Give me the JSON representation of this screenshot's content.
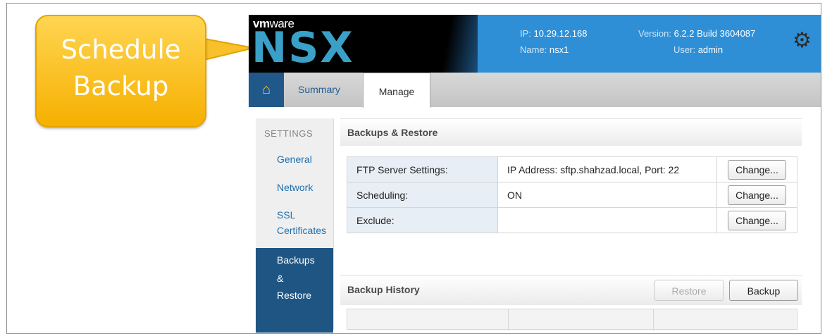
{
  "callout": {
    "line1": "Schedule",
    "line2": "Backup"
  },
  "header": {
    "brand_vm": "vm",
    "brand_ware": "ware",
    "product": "NSX",
    "ip_label": "IP:",
    "ip_value": "10.29.12.168",
    "version_label": "Version:",
    "version_value": "6.2.2 Build 3604087",
    "name_label": "Name:",
    "name_value": "nsx1",
    "user_label": "User:",
    "user_value": "admin"
  },
  "tabs": {
    "summary": "Summary",
    "manage": "Manage"
  },
  "sidebar": {
    "heading": "SETTINGS",
    "items": [
      "General",
      "Network",
      "SSL Certificates"
    ],
    "active": {
      "line1": "Backups",
      "line2": "&",
      "line3": "Restore"
    }
  },
  "backups_section": {
    "title": "Backups & Restore",
    "rows": [
      {
        "label": "FTP Server Settings:",
        "value": "IP Address: sftp.shahzad.local, Port: 22",
        "button": "Change..."
      },
      {
        "label": "Scheduling:",
        "value": "ON",
        "button": "Change..."
      },
      {
        "label": "Exclude:",
        "value": "",
        "button": "Change..."
      }
    ]
  },
  "history_section": {
    "title": "Backup History",
    "restore_button": "Restore",
    "backup_button": "Backup"
  },
  "colors": {
    "header_blue": "#2f8fd6",
    "active_nav": "#1f5583",
    "callout_gold": "#f6b000"
  }
}
